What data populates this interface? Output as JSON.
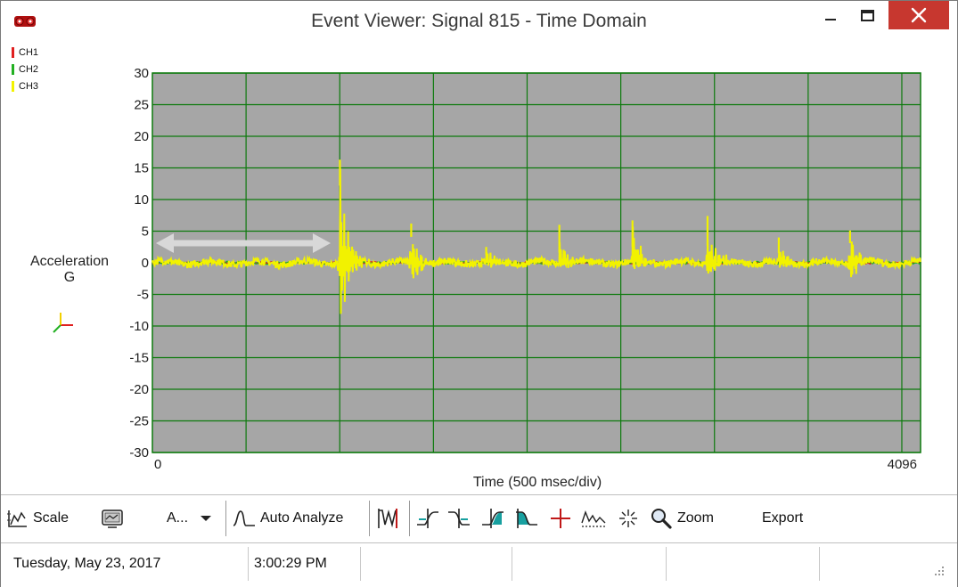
{
  "window": {
    "title": "Event Viewer: Signal  815  - Time Domain",
    "controls": {
      "minimize": "minimize-icon",
      "maximize": "maximize-icon",
      "close": "close-icon"
    }
  },
  "legend": [
    {
      "label": "CH1",
      "color": "#e02020"
    },
    {
      "label": "CH2",
      "color": "#22b022"
    },
    {
      "label": "CH3",
      "color": "#f2f200"
    }
  ],
  "chart_data": {
    "type": "line",
    "title": "",
    "ylabel_line1": "Acceleration",
    "ylabel_line2": "G",
    "xlabel": "Time (500 msec/div)",
    "ylim": [
      -30,
      30
    ],
    "xlim": [
      0,
      4096
    ],
    "yticks": [
      "30",
      "25",
      "20",
      "15",
      "10",
      "5",
      "0",
      "-5",
      "-10",
      "-15",
      "-20",
      "-25",
      "-30"
    ],
    "xtick_labels": [
      "0",
      "4096"
    ],
    "grid": true,
    "plot_background": "#a6a6a6",
    "grid_color": "#0d7a0d",
    "events": [
      {
        "x": 1000,
        "peak": 16.3,
        "trough": -12.2
      },
      {
        "x": 1380,
        "peak": 6.2,
        "trough": -4.1
      },
      {
        "x": 1780,
        "peak": 2.5,
        "trough": -1.2
      },
      {
        "x": 2170,
        "peak": 6.0,
        "trough": -1.6
      },
      {
        "x": 2560,
        "peak": 6.7,
        "trough": -2.5
      },
      {
        "x": 2960,
        "peak": 7.4,
        "trough": -2.7
      },
      {
        "x": 3340,
        "peak": 4.0,
        "trough": -1.5
      },
      {
        "x": 3720,
        "peak": 5.1,
        "trough": -3.1
      }
    ],
    "baseline_noise": 0.9
  },
  "toolbar": {
    "scale_label": "Scale",
    "a_label": "A...",
    "auto_analyze_label": "Auto Analyze",
    "zoom_label": "Zoom",
    "export_label": "Export"
  },
  "status": {
    "date": "Tuesday, May 23, 2017",
    "time": "3:00:29 PM"
  }
}
